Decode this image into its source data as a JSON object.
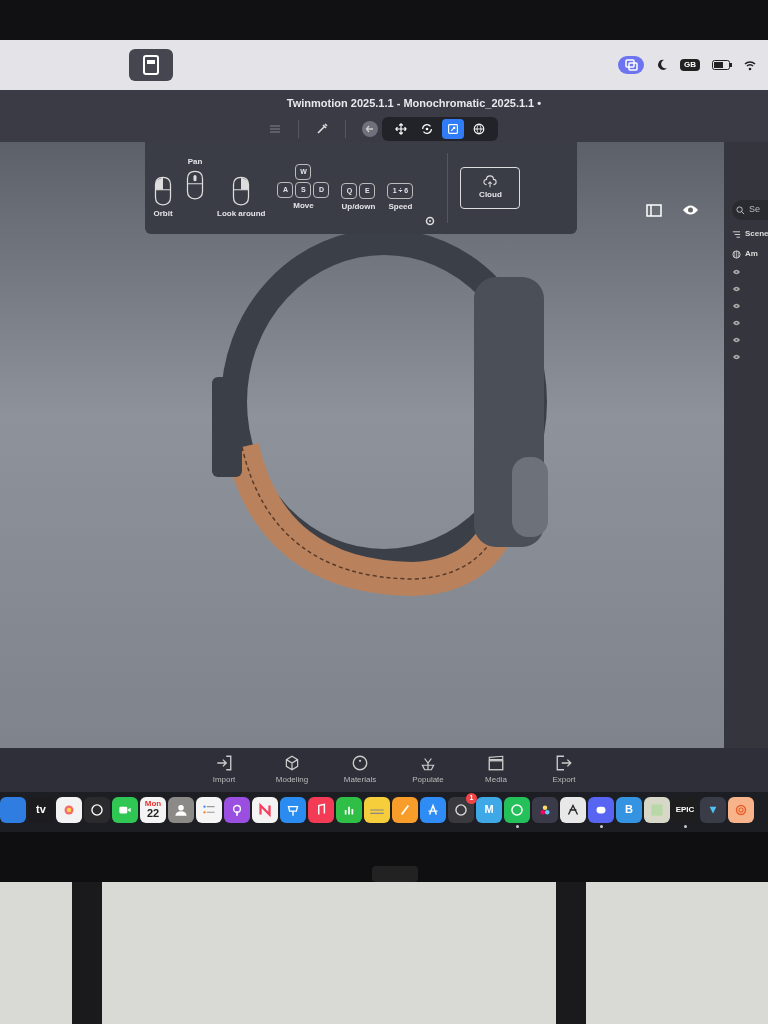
{
  "menu_bar": {
    "status_badge": "GB"
  },
  "window": {
    "title": "Twinmotion 2025.1.1 - Monochromatic_2025.1.1 •"
  },
  "view_tools": [
    {
      "kind": "move",
      "selected": false
    },
    {
      "kind": "rotate",
      "selected": false
    },
    {
      "kind": "scale",
      "selected": true
    },
    {
      "kind": "globe",
      "selected": false
    }
  ],
  "navigation_help": {
    "mouse": [
      {
        "kind": "left",
        "label": "Orbit"
      },
      {
        "kind": "middle",
        "label": "Pan"
      },
      {
        "kind": "right",
        "label": "Look around"
      }
    ],
    "move": {
      "keys": [
        "W",
        "A",
        "S",
        "D"
      ],
      "label": "Move"
    },
    "up_down": {
      "keys": [
        "Q",
        "E"
      ],
      "label": "Up/down"
    },
    "speed": {
      "key": "1 ÷ 6",
      "label": "Speed"
    },
    "cloud": {
      "label": "Cloud"
    }
  },
  "scene_panel": {
    "search": {
      "placeholder": "Se"
    },
    "heading": "Scene",
    "items": [
      {
        "label": "Am"
      }
    ]
  },
  "bottom_toolbar": [
    {
      "kind": "import",
      "label": "Import"
    },
    {
      "kind": "modeling",
      "label": "Modeling"
    },
    {
      "kind": "materials",
      "label": "Materials"
    },
    {
      "kind": "populate",
      "label": "Populate"
    },
    {
      "kind": "media",
      "label": "Media"
    },
    {
      "kind": "export",
      "label": "Export"
    }
  ],
  "dock": [
    {
      "kind": "finder",
      "running": false
    },
    {
      "kind": "tv",
      "text": "tv",
      "running": false
    },
    {
      "kind": "photos",
      "running": false
    },
    {
      "kind": "chat",
      "running": false
    },
    {
      "kind": "video",
      "running": false
    },
    {
      "kind": "calendar",
      "text": "Mon",
      "subtext": "22",
      "running": false
    },
    {
      "kind": "contacts",
      "running": false
    },
    {
      "kind": "reminders",
      "running": false
    },
    {
      "kind": "podcasts",
      "running": false
    },
    {
      "kind": "news",
      "running": false
    },
    {
      "kind": "keynote",
      "running": false
    },
    {
      "kind": "music",
      "running": false
    },
    {
      "kind": "numbers",
      "running": false
    },
    {
      "kind": "notes",
      "running": false
    },
    {
      "kind": "pages",
      "running": false
    },
    {
      "kind": "appstore",
      "running": false
    },
    {
      "kind": "wheel",
      "badge": "1",
      "running": false
    },
    {
      "kind": "letter",
      "text": "M",
      "running": false
    },
    {
      "kind": "whatsapp",
      "running": true
    },
    {
      "kind": "resolve",
      "running": false
    },
    {
      "kind": "figure",
      "running": false
    },
    {
      "kind": "discord",
      "running": true
    },
    {
      "kind": "letterblue",
      "text": "B",
      "running": false
    },
    {
      "kind": "image",
      "running": false
    },
    {
      "kind": "epic",
      "text": "EPIC",
      "running": true
    },
    {
      "kind": "vee",
      "running": false
    },
    {
      "kind": "spiral",
      "running": false
    }
  ]
}
